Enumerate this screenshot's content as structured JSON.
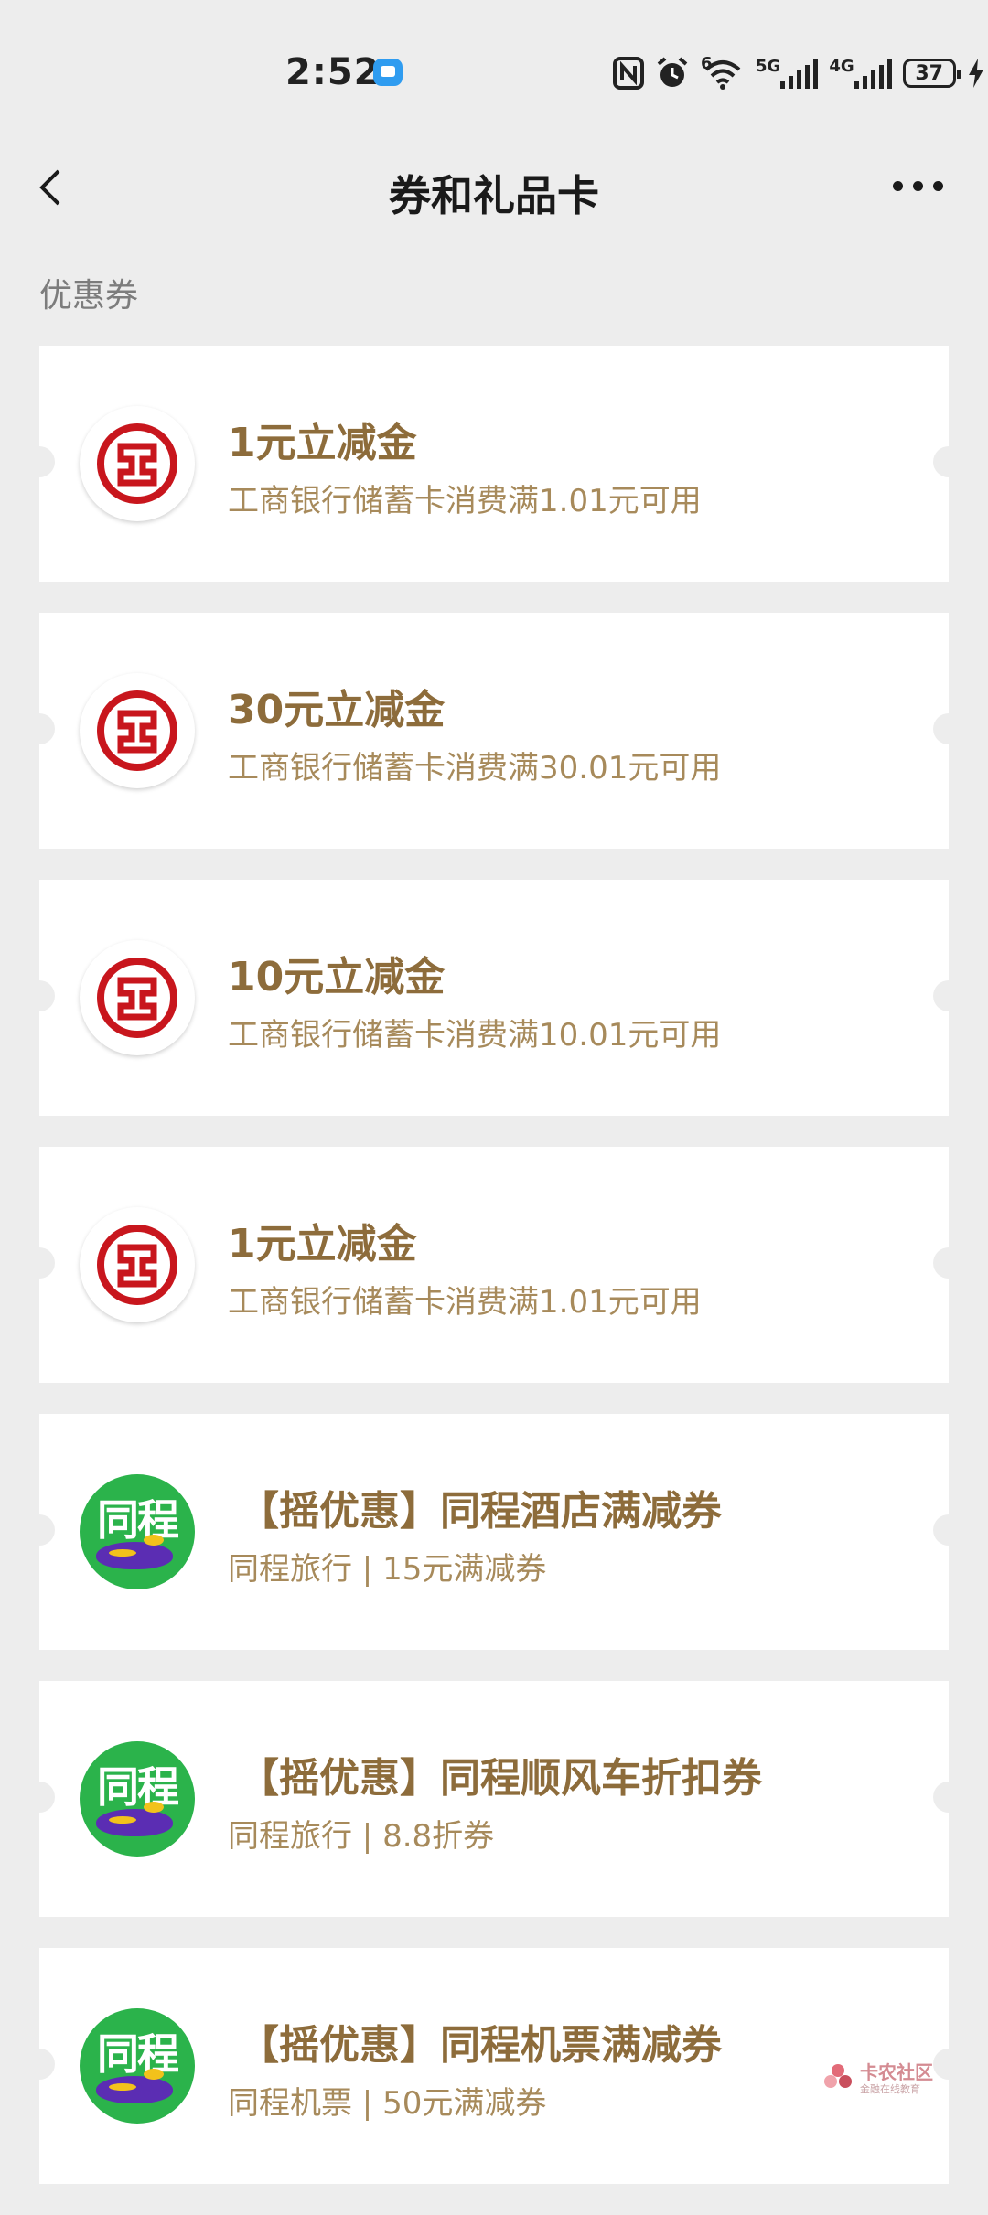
{
  "status_bar": {
    "time": "2:52",
    "network_1": "5G",
    "network_2": "4G",
    "battery": "37",
    "wifi_label": "6"
  },
  "nav": {
    "title": "券和礼品卡"
  },
  "section": {
    "label": "优惠券"
  },
  "coupons": [
    {
      "logo": "icbc-logo",
      "title": "1元立减金",
      "subtitle": "工商银行储蓄卡消费满1.01元可用"
    },
    {
      "logo": "icbc-logo",
      "title": "30元立减金",
      "subtitle": "工商银行储蓄卡消费满30.01元可用"
    },
    {
      "logo": "icbc-logo",
      "title": "10元立减金",
      "subtitle": "工商银行储蓄卡消费满10.01元可用"
    },
    {
      "logo": "icbc-logo",
      "title": "1元立减金",
      "subtitle": "工商银行储蓄卡消费满1.01元可用"
    },
    {
      "logo": "tongcheng-logo",
      "logo_text": "同程",
      "title": "【摇优惠】同程酒店满减券",
      "subtitle": "同程旅行 | 15元满减券"
    },
    {
      "logo": "tongcheng-logo",
      "logo_text": "同程",
      "title": "【摇优惠】同程顺风车折扣券",
      "subtitle": "同程旅行 | 8.8折券"
    },
    {
      "logo": "tongcheng-logo",
      "logo_text": "同程",
      "title": "【摇优惠】同程机票满减券",
      "subtitle": "同程机票 | 50元满减券"
    }
  ],
  "watermark": {
    "text": "卡农社区",
    "sub": "金融在线教育"
  },
  "colors": {
    "background": "#ededed",
    "card": "#ffffff",
    "title_gold": "#8d6c3b",
    "subtitle_gold": "#a78a5b",
    "icbc_red": "#c8161d",
    "tongcheng_green": "#2bb34b"
  }
}
